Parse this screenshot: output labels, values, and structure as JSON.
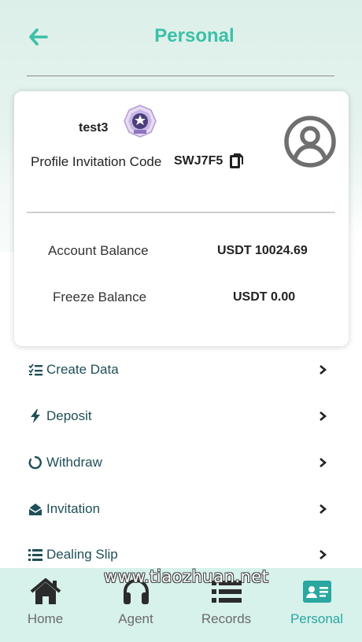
{
  "header": {
    "title": "Personal"
  },
  "profile": {
    "username": "test3",
    "invite_label": "Profile Invitation Code",
    "invite_code": "SWJ7F5"
  },
  "balances": [
    {
      "label": "Account Balance",
      "value": "USDT 10024.69"
    },
    {
      "label": "Freeze Balance",
      "value": "USDT 0.00"
    }
  ],
  "menu": [
    {
      "label": "Create Data",
      "icon": "checklist-icon"
    },
    {
      "label": "Deposit",
      "icon": "bolt-icon"
    },
    {
      "label": "Withdraw",
      "icon": "circle-notch-icon"
    },
    {
      "label": "Invitation",
      "icon": "envelope-open-icon"
    },
    {
      "label": "Dealing Slip",
      "icon": "list-icon"
    }
  ],
  "nav": [
    {
      "label": "Home",
      "icon": "home-icon"
    },
    {
      "label": "Agent",
      "icon": "headset-icon"
    },
    {
      "label": "Records",
      "icon": "records-icon"
    },
    {
      "label": "Personal",
      "icon": "id-card-icon",
      "active": true
    }
  ],
  "watermark": "www.tiaozhuan.net",
  "colors": {
    "accent": "#3cc0a8",
    "nav_bg": "#d7f1eb",
    "menu_text": "#1f4f57"
  }
}
